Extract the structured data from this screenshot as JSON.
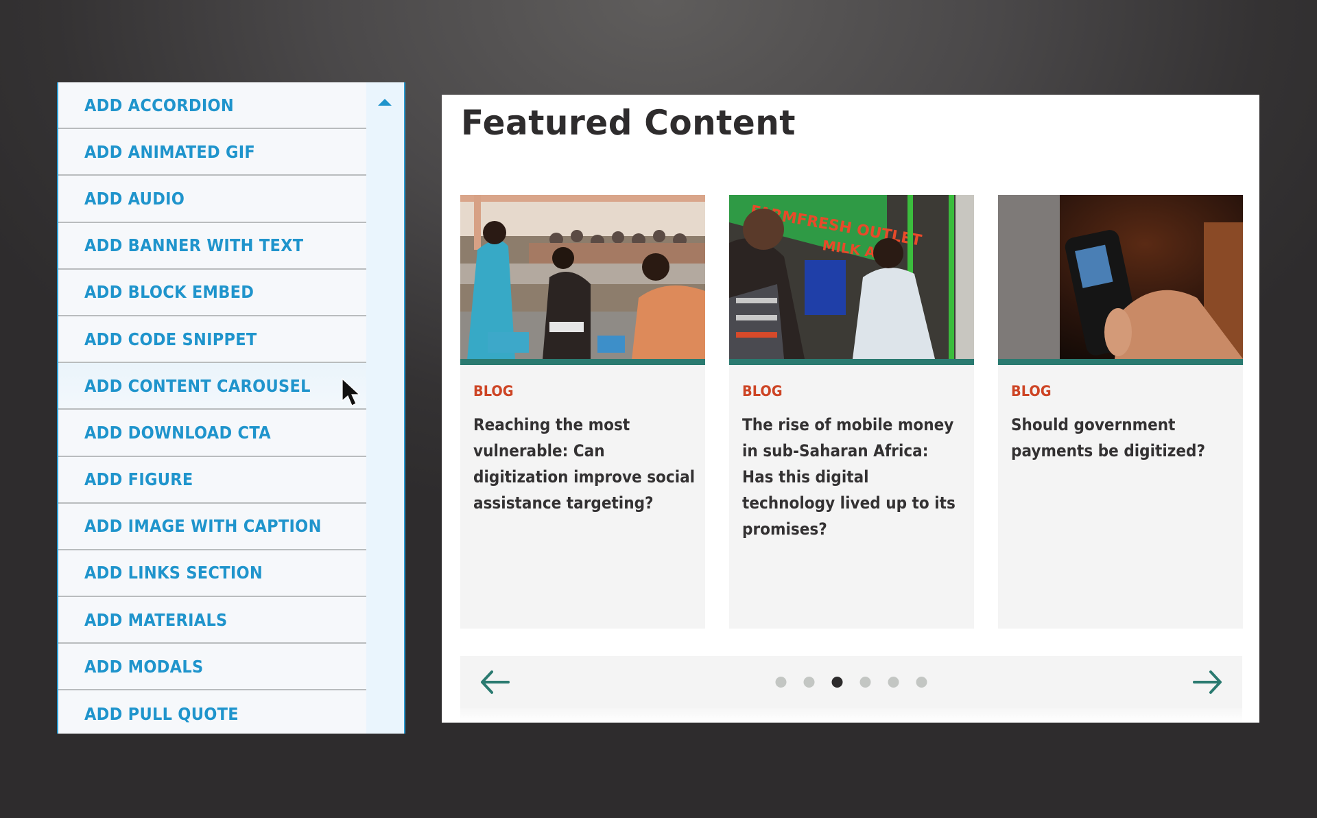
{
  "menu": {
    "items": [
      {
        "label": "ADD ACCORDION"
      },
      {
        "label": "ADD ANIMATED GIF"
      },
      {
        "label": "ADD AUDIO"
      },
      {
        "label": "ADD BANNER WITH TEXT"
      },
      {
        "label": "ADD BLOCK EMBED"
      },
      {
        "label": "ADD CODE SNIPPET"
      },
      {
        "label": "ADD CONTENT CAROUSEL",
        "hovered": true
      },
      {
        "label": "ADD DOWNLOAD CTA"
      },
      {
        "label": "ADD FIGURE"
      },
      {
        "label": "ADD IMAGE WITH CAPTION"
      },
      {
        "label": "ADD LINKS SECTION"
      },
      {
        "label": "ADD MATERIALS"
      },
      {
        "label": "ADD MODALS"
      },
      {
        "label": "ADD PULL QUOTE"
      }
    ],
    "scroll_up_icon": "triangle-up-icon"
  },
  "featured": {
    "title": "Featured Content",
    "cards": [
      {
        "type": "BLOG",
        "title": "Reaching the most vulnerable: Can digitization improve social assistance targeting?",
        "image": "people-at-table-photo"
      },
      {
        "type": "BLOG",
        "title": "The rise of mobile money in sub-Saharan Africa: Has this digital technology lived up to its promises?",
        "image": "milk-atm-photo",
        "image_sign_text": "FARMFRESH OUTLET LIMITED MILK ATM"
      },
      {
        "type": "BLOG",
        "title": "Should government payments be digitized?",
        "image": "hand-holding-phone-photo"
      }
    ],
    "carousel": {
      "prev_icon": "arrow-left-icon",
      "next_icon": "arrow-right-icon",
      "page_count": 6,
      "active_page": 3
    }
  },
  "colors": {
    "menu_text": "#1f94cc",
    "menu_border": "#2a9ad0",
    "card_type": "#cd4424",
    "accent_teal": "#2a7a70",
    "title_text": "#2e2c2d",
    "dot_inactive": "#c3c6c3",
    "dot_active": "#2d2b2c"
  }
}
